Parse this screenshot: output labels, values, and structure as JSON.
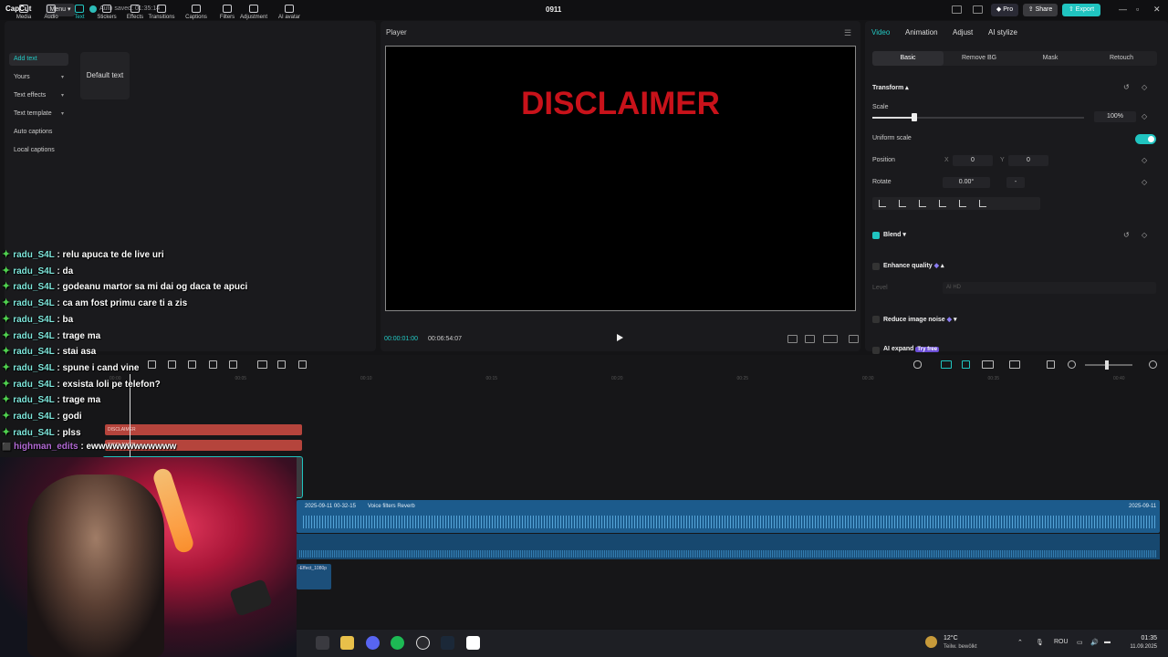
{
  "app": {
    "logo": "CapCut",
    "menu_label": "Menu",
    "autosave": "Auto saved: 01:35:14",
    "project_name": "0911",
    "pro_label": "Pro",
    "share_label": "Share",
    "export_label": "Export"
  },
  "toolbar": {
    "tools": [
      {
        "label": "Media",
        "icon": "media-icon"
      },
      {
        "label": "Audio",
        "icon": "audio-icon"
      },
      {
        "label": "Text",
        "icon": "text-icon",
        "active": true
      },
      {
        "label": "Stickers",
        "icon": "stickers-icon"
      },
      {
        "label": "Effects",
        "icon": "effects-icon"
      },
      {
        "label": "Transitions",
        "icon": "transitions-icon"
      },
      {
        "label": "Captions",
        "icon": "captions-icon"
      },
      {
        "label": "Filters",
        "icon": "filters-icon"
      },
      {
        "label": "Adjustment",
        "icon": "adjustment-icon"
      },
      {
        "label": "AI avatar",
        "icon": "ai-avatar-icon"
      }
    ]
  },
  "sidebar": {
    "items": [
      {
        "label": "Add text",
        "active": true
      },
      {
        "label": "Yours",
        "dropdown": true
      },
      {
        "label": "Text effects",
        "dropdown": true
      },
      {
        "label": "Text template",
        "dropdown": true
      },
      {
        "label": "Auto captions"
      },
      {
        "label": "Local captions"
      }
    ],
    "default_text": "Default text"
  },
  "player": {
    "title": "Player",
    "overlay_text": "DISCLAIMER",
    "current_time": "00:00:01:00",
    "total_time": "00:06:54:07"
  },
  "inspector": {
    "tabs": [
      "Video",
      "Animation",
      "Adjust",
      "AI stylize"
    ],
    "subtabs": [
      "Basic",
      "Remove BG",
      "Mask",
      "Retouch"
    ],
    "transform_label": "Transform",
    "scale_label": "Scale",
    "scale_value": "100%",
    "scale_fraction": 0.2,
    "uniform_scale_label": "Uniform scale",
    "position_label": "Position",
    "x_label": "X",
    "x_value": "0",
    "y_label": "Y",
    "y_value": "0",
    "rotate_label": "Rotate",
    "rotate_value": "0.00°",
    "rotate_extra": "-",
    "blend_label": "Blend",
    "enhance_label": "Enhance quality",
    "level_label": "Level",
    "level_value": "AI HD",
    "noise_label": "Reduce image noise",
    "expand_label": "AI expand",
    "expand_badge": "Try free"
  },
  "timeline": {
    "ticks": [
      "00:00",
      "00:05",
      "00:10",
      "00:15",
      "00:20",
      "00:25",
      "00:30",
      "00:35",
      "00:40"
    ],
    "clip1_label": "DISCLAIMER",
    "clip2_label": "DISCLAIMER",
    "audio_date": "2025-09-11 00-32-15",
    "audio_effect": "Voice filters Reverb",
    "audio_date_end": "2025-09-11",
    "small_clip_label": "-Effect_1080p"
  },
  "chat": [
    {
      "user": "radu_S4L",
      "msg": "relu apuca te de live uri"
    },
    {
      "user": "radu_S4L",
      "msg": "da"
    },
    {
      "user": "radu_S4L",
      "msg": "godeanu martor sa mi dai og daca te apuci"
    },
    {
      "user": "radu_S4L",
      "msg": "ca am fost primu care ti a zis"
    },
    {
      "user": "radu_S4L",
      "msg": "ba"
    },
    {
      "user": "radu_S4L",
      "msg": "trage ma"
    },
    {
      "user": "radu_S4L",
      "msg": "stai asa"
    },
    {
      "user": "radu_S4L",
      "msg": "spune i cand vine"
    },
    {
      "user": "radu_S4L",
      "msg": "exsista loli pe telefon?"
    },
    {
      "user": "radu_S4L",
      "msg": "trage ma"
    },
    {
      "user": "radu_S4L",
      "msg": "godi"
    },
    {
      "user": "radu_S4L",
      "msg": "plss"
    },
    {
      "user": "highman_edits",
      "msg": "ewwwwwwwwwwww",
      "alt": true
    }
  ],
  "taskbar": {
    "temp": "12°C",
    "weather": "Teilw. bewölkt",
    "lang": "ROU",
    "time": "01:35",
    "date": "11.09.2025"
  },
  "colors": {
    "accent": "#20c4c0",
    "disclaimer": "#c8121a",
    "audio": "#1c5b8c",
    "clip": "#b5443c"
  }
}
